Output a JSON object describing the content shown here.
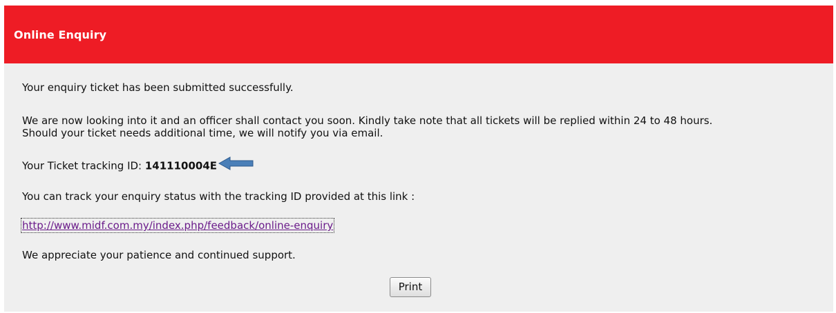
{
  "header": {
    "title": "Online Enquiry"
  },
  "message": {
    "success": "Your enquiry ticket has been submitted successfully.",
    "notice_line1": "We are now looking into it and an officer shall contact you soon. Kindly take note that all tickets will be replied within 24 to 48 hours.",
    "notice_line2": "Should your ticket needs additional time, we will notify you via email.",
    "tracking_label": "Your Ticket tracking ID: ",
    "tracking_id": "141110004E",
    "track_info": "You can track your enquiry status with the tracking ID provided at this link :",
    "link": "http://www.midf.com.my/index.php/feedback/online-enquiry",
    "closing": "We appreciate your patience and continued support."
  },
  "actions": {
    "print_label": "Print"
  },
  "colors": {
    "header_bg": "#ee1c25",
    "panel_bg": "#efefef",
    "arrow": "#4a7fb8",
    "link": "#6a1b8a"
  },
  "icons": {
    "arrow": "left-arrow-icon"
  }
}
